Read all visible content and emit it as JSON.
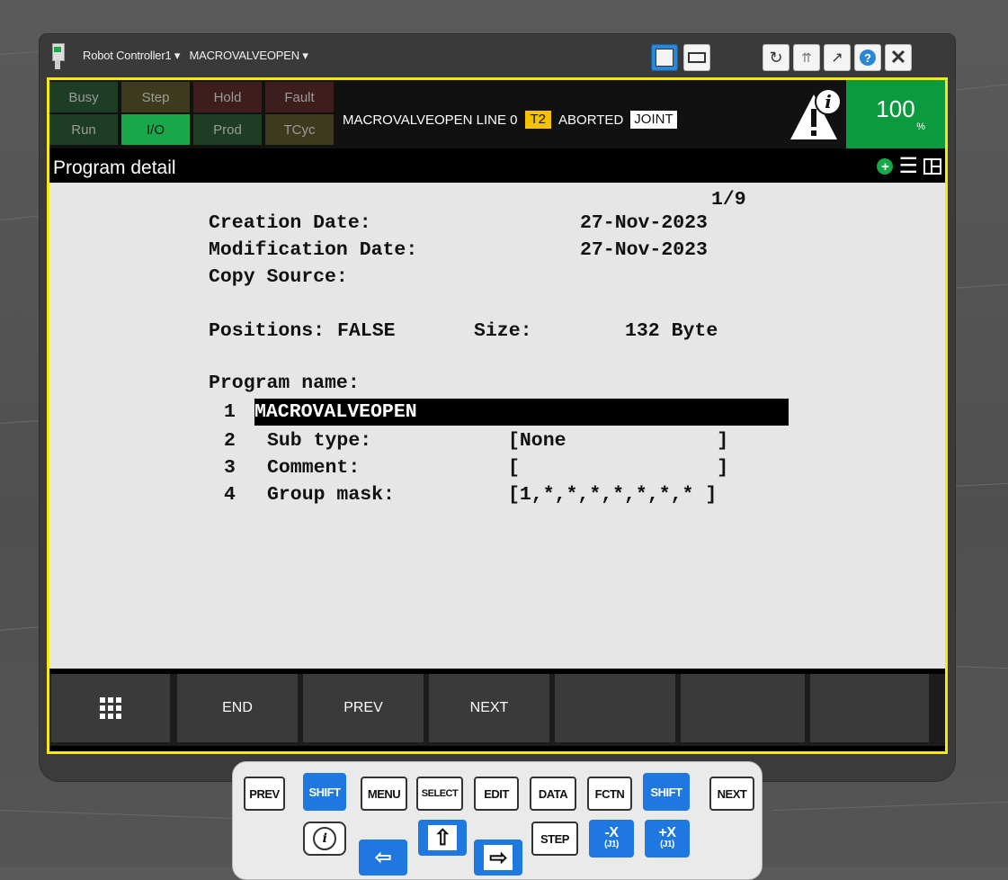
{
  "window": {
    "controller_label": "Robot Controller1",
    "program_label": "MACROVALVEOPEN"
  },
  "indicators": [
    {
      "label": "Busy",
      "state": "off"
    },
    {
      "label": "Step",
      "state": "off"
    },
    {
      "label": "Hold",
      "state": "off"
    },
    {
      "label": "Fault",
      "state": "off"
    },
    {
      "label": "Run",
      "state": "off"
    },
    {
      "label": "I/O",
      "state": "on"
    },
    {
      "label": "Prod",
      "state": "off"
    },
    {
      "label": "TCyc",
      "state": "off"
    }
  ],
  "status": {
    "line_text": "MACROVALVEOPEN LINE 0",
    "mode": "T2",
    "state": "ABORTED",
    "coord": "JOINT",
    "override": "100",
    "override_unit": "%"
  },
  "screen": {
    "title": "Program detail",
    "page": "1/9"
  },
  "detail": {
    "creation_label": "Creation Date:",
    "creation_value": "27-Nov-2023",
    "modification_label": "Modification Date:",
    "modification_value": "27-Nov-2023",
    "copy_source_label": "Copy Source:",
    "positions_label": "Positions:",
    "positions_value": "FALSE",
    "size_label": "Size:",
    "size_value": "132 Byte",
    "program_name_label": "Program name:"
  },
  "fields": [
    {
      "num": "1",
      "label": "",
      "value": "MACROVALVEOPEN"
    },
    {
      "num": "2",
      "label": "Sub type:",
      "value": "[None             ]"
    },
    {
      "num": "3",
      "label": "Comment:",
      "value": "[                 ]"
    },
    {
      "num": "4",
      "label": "Group mask:",
      "value": "[1,*,*,*,*,*,*,* ]"
    }
  ],
  "softkeys": [
    "",
    "END",
    "PREV",
    "NEXT",
    "",
    "",
    ""
  ],
  "keypad": {
    "row1": [
      "PREV",
      "SHIFT",
      "MENU",
      "SELECT",
      "EDIT",
      "DATA",
      "FCTN",
      "SHIFT",
      "NEXT"
    ],
    "info": "i",
    "step": "STEP",
    "jog_minus_x": "-X",
    "jog_minus_x_sub": "(J1)",
    "jog_plus_x": "+X",
    "jog_plus_x_sub": "(J1)"
  }
}
